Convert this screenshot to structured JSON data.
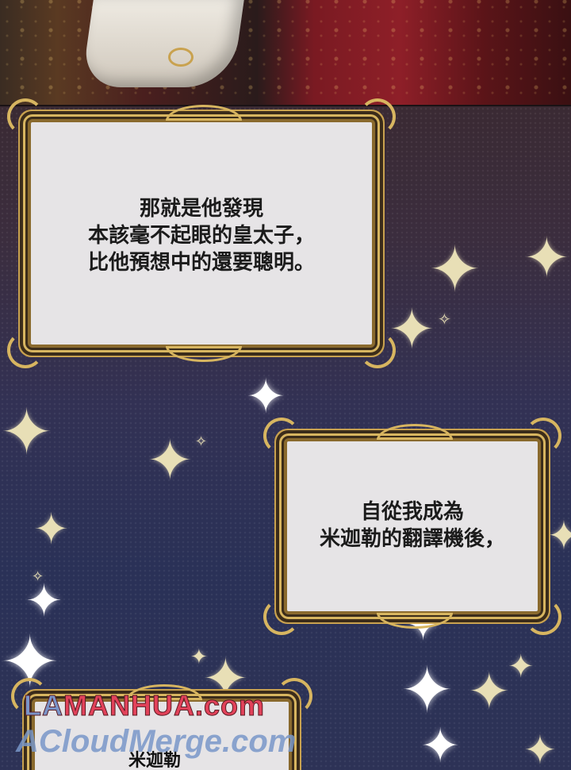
{
  "panels": {
    "caption1": {
      "lines": [
        "那就是他發現",
        "本該毫不起眼的皇太子，",
        "比他預想中的還要聰明。"
      ]
    },
    "caption2": {
      "lines": [
        "自從我成為",
        "米迦勒的翻譯機後，"
      ]
    },
    "caption3": {
      "speaker": "米迦勒"
    }
  },
  "watermark": {
    "line1": "MANHUA.com",
    "line1_prefix": "LA",
    "line2": "ACloudMerge.com"
  },
  "stars": {
    "glyph": "✦",
    "small_glyph": "✧"
  },
  "colors": {
    "sky_top": "#3a2a33",
    "sky_bottom": "#2d3256",
    "frame_gold": "#d7b560",
    "caption_bg": "#e6e4e6",
    "watermark_red": "#e2425a"
  }
}
